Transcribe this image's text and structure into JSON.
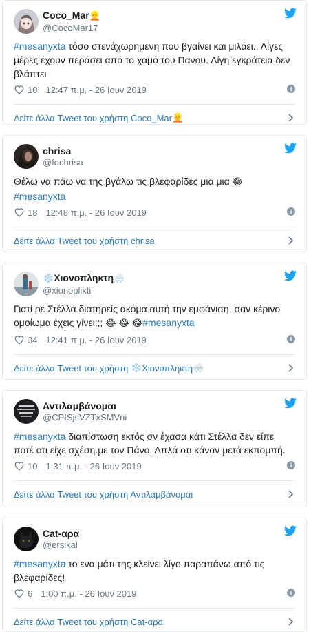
{
  "colors": {
    "link": "#2b7bb9",
    "muted": "#697882",
    "border": "#e1e8ed",
    "bird": "#1da1f2"
  },
  "tweets": [
    {
      "display_name": "Coco_Mar",
      "name_emoji": "👱",
      "handle": "@CocoMar17",
      "hashtag": "#mesanyxta",
      "text": "τόσο στενάχωρημενη που βγαίνει και μιλάει.. Λίγες μέρες έχουν περάσει από το χαμό του Πανου. Λίγη εγκράτεια δεν βλάπτει",
      "likes": "10",
      "time": "12:47 π.μ. - 26 Ιουν 2019",
      "more_link": "Δείτε άλλα Tweet του χρήστη Coco_Mar",
      "more_emoji": "👱",
      "avatar_icon": "anime-girl-avatar"
    },
    {
      "display_name": "chrisa",
      "name_emoji": "",
      "handle": "@fochrisa",
      "text_before": "Θέλω να πάω να της βγάλω τις βλεφαρίδες μια μια",
      "text_emoji": "😂",
      "hashtag": "#mesanyxta",
      "likes": "18",
      "time": "12:48 π.μ. - 26 Ιουν 2019",
      "more_link": "Δείτε άλλα Tweet του χρήστη chrisa",
      "more_emoji": "",
      "avatar_icon": "dark-portrait-avatar"
    },
    {
      "display_name": "Χιονοπληκτη",
      "name_prefix_emoji": "❄️",
      "name_emoji": "🌨️",
      "handle": "@xionoplikti",
      "text": "Γιατί ρε Στέλλα διατηρείς ακόμα αυτή την εμφάνιση, σαν κέρινο ομοίωμα έχεις γίνει;;;",
      "text_emojis": "😂 😂 😂",
      "hashtag": "#mesanyxta",
      "likes": "34",
      "time": "12:41 π.μ. - 26 Ιουν 2019",
      "more_link": "Δείτε άλλα Tweet του χρήστη",
      "more_prefix_emoji": "❄️",
      "more_name": "Χιονοπληκτη",
      "more_emoji": "🌨️",
      "avatar_icon": "snowy-photo-avatar"
    },
    {
      "display_name": "Αντιλαμβάνομαι",
      "name_emoji": "",
      "handle": "@CPISjsVZTxSMVni",
      "hashtag": "#mesanyxta",
      "text": "διαπίστωση εκτός σν έχασα κάτι Στέλλα δεν είπε ποτέ οτι είχε σχέση.με τον Πάνο. Απλά οτι κάναν μετά εκπομπή.",
      "likes": "10",
      "time": "1:31 π.μ. - 26 Ιουν 2019",
      "more_link": "Δείτε άλλα Tweet του χρήστη Αντιλαμβάνομαι",
      "more_emoji": "",
      "avatar_icon": "text-image-avatar"
    },
    {
      "display_name": "Cat-αρα",
      "name_emoji": "",
      "handle": "@ersikal",
      "hashtag": "#mesanyxta",
      "text": "το ενα μάτι της κλείνει λίγο παραπάνω από τις βλεφαρίδες!",
      "likes": "6",
      "time": "1:00 π.μ. - 26 Ιουν 2019",
      "more_link": "Δείτε άλλα Tweet του χρήστη Cat-αρα",
      "more_emoji": "",
      "avatar_icon": "black-cat-avatar"
    }
  ]
}
